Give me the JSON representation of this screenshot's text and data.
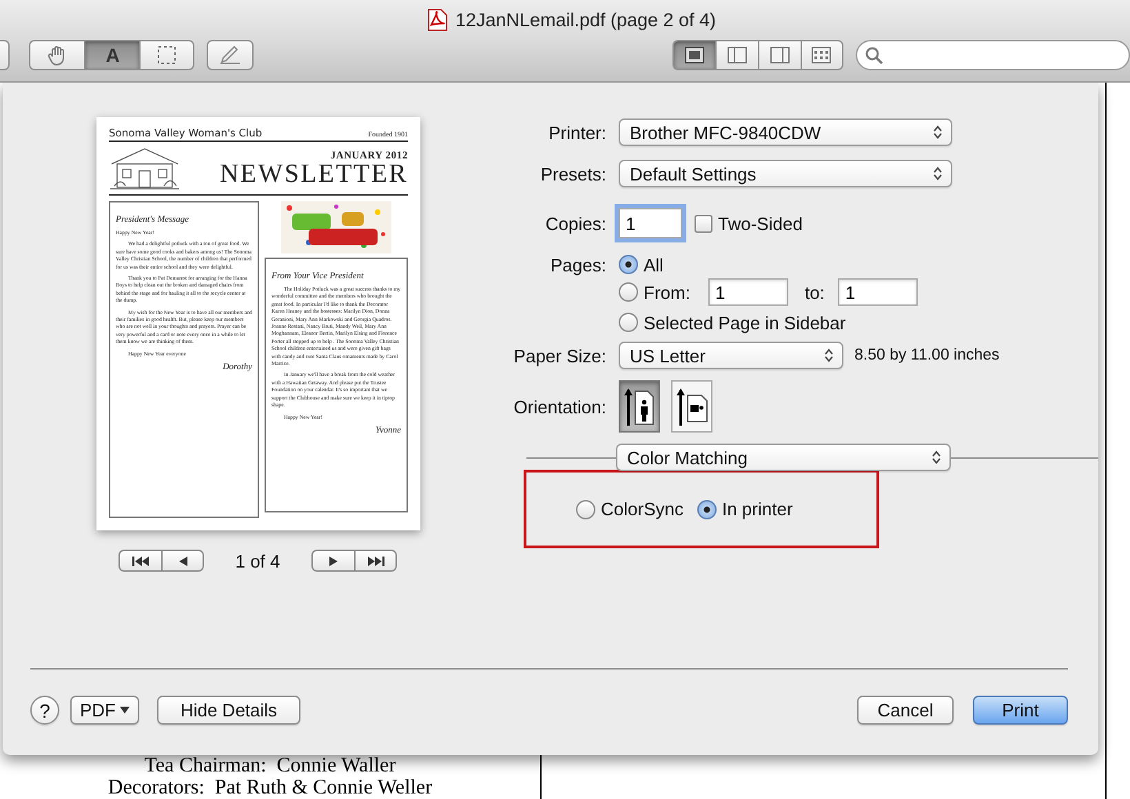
{
  "window": {
    "title": "12JanNLemail.pdf (page 2 of 4)"
  },
  "toolbar": {
    "tools": [
      {
        "kind": "hand",
        "selected": false
      },
      {
        "kind": "text",
        "label": "A",
        "selected": true
      },
      {
        "kind": "marquee",
        "selected": false
      }
    ],
    "views": [
      {
        "kind": "content",
        "selected": true
      },
      {
        "kind": "sidebar_left",
        "selected": false
      },
      {
        "kind": "sidebar_right",
        "selected": false
      },
      {
        "kind": "grid",
        "selected": false
      }
    ]
  },
  "print_sheet": {
    "preview": {
      "club": "Sonoma Valley Woman's Club",
      "founded": "Founded 1901",
      "issue": "JANUARY 2012",
      "title": "NEWSLETTER",
      "columns": [
        {
          "heading": "President's Message",
          "paragraphs": [
            {
              "kind": "plain",
              "text": "Happy New Year!"
            },
            {
              "kind": "indented",
              "text": "We had a delightful potluck with a ton of great food.  We sure have some good cooks and bakers among us!  The Sonoma Valley Christian School, the number of children that performed for us was their entire school and they were delightful."
            },
            {
              "kind": "indented",
              "text": "Thank you to Pat Demarest for arranging for the Hanna Boys to help clean out the broken and damaged chairs from behind the stage and for hauling it all to the recycle center at the dump."
            },
            {
              "kind": "indented",
              "text": "My wish for the New Year is to have all our members and their families in good health. But, please keep our members who are not well in your thoughts and prayers.  Prayer can be very powerful and a card or note every once in a while to let them know we are thinking of them."
            },
            {
              "kind": "closing",
              "text": "Happy New Year everyone"
            }
          ],
          "signature": "Dorothy"
        },
        {
          "heading": "From Your Vice President",
          "paragraphs": [
            {
              "kind": "indented",
              "text": "The Holiday Potluck was a great success thanks to my wonderful committee and the members who brought the great food.  In particular I'd like to thank the Decorator Karen Heaney and the hostesses:  Marilyn Dion, Donna Geranioni, Mary Ann Markowski and Georgia Quadros.  Joanne Restani, Nancy Bruti, Mandy Weil, Mary Ann Moghannam, Eleanor Bertin, Marilyn Elsing and Florence Porter all stepped up to help .  The Sonoma Valley Christian School children entertained us and were given gift bags with candy and cute Santa Claus ornaments made by Carol Marrice."
            },
            {
              "kind": "indented",
              "text": "In January we'll have a break from the cold weather with a Hawaiian Getaway.  And please put the Trustee Foundation on your calendar.  It's so important that we support the Clubhouse and make sure we keep it in tiptop shape."
            },
            {
              "kind": "closing",
              "text": "Happy New Year!"
            }
          ],
          "signature": "Yvonne"
        }
      ]
    },
    "pager": "1 of 4",
    "printer": {
      "label": "Printer:",
      "value": "Brother MFC-9840CDW"
    },
    "presets": {
      "label": "Presets:",
      "value": "Default Settings"
    },
    "copies": {
      "label": "Copies:",
      "value": "1"
    },
    "two_sided": {
      "label": "Two-Sided",
      "checked": false
    },
    "pages": {
      "label": "Pages:",
      "options": [
        {
          "kind": "all",
          "label": "All",
          "selected": true
        },
        {
          "kind": "range",
          "label": "From:",
          "selected": false,
          "from": "1",
          "to_label": "to:",
          "to": "1"
        },
        {
          "kind": "plain",
          "label": "Selected Page in Sidebar",
          "selected": false
        }
      ]
    },
    "paper_size": {
      "label": "Paper Size:",
      "value": "US Letter",
      "dimensions": "8.50 by 11.00 inches"
    },
    "orientation": {
      "label": "Orientation:",
      "options": [
        {
          "kind": "portrait",
          "selected": true
        },
        {
          "kind": "landscape",
          "selected": false
        }
      ]
    },
    "section": "Color Matching",
    "color_matching": [
      {
        "label": "ColorSync",
        "selected": false
      },
      {
        "label": "In printer",
        "selected": true
      }
    ],
    "buttons": {
      "help": "?",
      "pdf": "PDF",
      "hide_details": "Hide Details",
      "cancel": "Cancel",
      "print": "Print"
    }
  },
  "document": {
    "lines": [
      "Tea Chairman:  Connie Waller",
      "Decorators:  Pat Ruth & Connie Weller"
    ]
  }
}
